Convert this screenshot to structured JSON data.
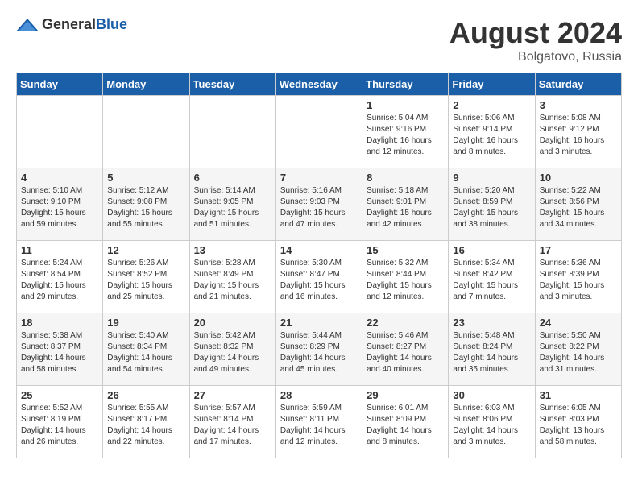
{
  "header": {
    "logo_general": "General",
    "logo_blue": "Blue",
    "month": "August 2024",
    "location": "Bolgatovo, Russia"
  },
  "weekdays": [
    "Sunday",
    "Monday",
    "Tuesday",
    "Wednesday",
    "Thursday",
    "Friday",
    "Saturday"
  ],
  "weeks": [
    [
      {
        "day": "",
        "info": ""
      },
      {
        "day": "",
        "info": ""
      },
      {
        "day": "",
        "info": ""
      },
      {
        "day": "",
        "info": ""
      },
      {
        "day": "1",
        "info": "Sunrise: 5:04 AM\nSunset: 9:16 PM\nDaylight: 16 hours\nand 12 minutes."
      },
      {
        "day": "2",
        "info": "Sunrise: 5:06 AM\nSunset: 9:14 PM\nDaylight: 16 hours\nand 8 minutes."
      },
      {
        "day": "3",
        "info": "Sunrise: 5:08 AM\nSunset: 9:12 PM\nDaylight: 16 hours\nand 3 minutes."
      }
    ],
    [
      {
        "day": "4",
        "info": "Sunrise: 5:10 AM\nSunset: 9:10 PM\nDaylight: 15 hours\nand 59 minutes."
      },
      {
        "day": "5",
        "info": "Sunrise: 5:12 AM\nSunset: 9:08 PM\nDaylight: 15 hours\nand 55 minutes."
      },
      {
        "day": "6",
        "info": "Sunrise: 5:14 AM\nSunset: 9:05 PM\nDaylight: 15 hours\nand 51 minutes."
      },
      {
        "day": "7",
        "info": "Sunrise: 5:16 AM\nSunset: 9:03 PM\nDaylight: 15 hours\nand 47 minutes."
      },
      {
        "day": "8",
        "info": "Sunrise: 5:18 AM\nSunset: 9:01 PM\nDaylight: 15 hours\nand 42 minutes."
      },
      {
        "day": "9",
        "info": "Sunrise: 5:20 AM\nSunset: 8:59 PM\nDaylight: 15 hours\nand 38 minutes."
      },
      {
        "day": "10",
        "info": "Sunrise: 5:22 AM\nSunset: 8:56 PM\nDaylight: 15 hours\nand 34 minutes."
      }
    ],
    [
      {
        "day": "11",
        "info": "Sunrise: 5:24 AM\nSunset: 8:54 PM\nDaylight: 15 hours\nand 29 minutes."
      },
      {
        "day": "12",
        "info": "Sunrise: 5:26 AM\nSunset: 8:52 PM\nDaylight: 15 hours\nand 25 minutes."
      },
      {
        "day": "13",
        "info": "Sunrise: 5:28 AM\nSunset: 8:49 PM\nDaylight: 15 hours\nand 21 minutes."
      },
      {
        "day": "14",
        "info": "Sunrise: 5:30 AM\nSunset: 8:47 PM\nDaylight: 15 hours\nand 16 minutes."
      },
      {
        "day": "15",
        "info": "Sunrise: 5:32 AM\nSunset: 8:44 PM\nDaylight: 15 hours\nand 12 minutes."
      },
      {
        "day": "16",
        "info": "Sunrise: 5:34 AM\nSunset: 8:42 PM\nDaylight: 15 hours\nand 7 minutes."
      },
      {
        "day": "17",
        "info": "Sunrise: 5:36 AM\nSunset: 8:39 PM\nDaylight: 15 hours\nand 3 minutes."
      }
    ],
    [
      {
        "day": "18",
        "info": "Sunrise: 5:38 AM\nSunset: 8:37 PM\nDaylight: 14 hours\nand 58 minutes."
      },
      {
        "day": "19",
        "info": "Sunrise: 5:40 AM\nSunset: 8:34 PM\nDaylight: 14 hours\nand 54 minutes."
      },
      {
        "day": "20",
        "info": "Sunrise: 5:42 AM\nSunset: 8:32 PM\nDaylight: 14 hours\nand 49 minutes."
      },
      {
        "day": "21",
        "info": "Sunrise: 5:44 AM\nSunset: 8:29 PM\nDaylight: 14 hours\nand 45 minutes."
      },
      {
        "day": "22",
        "info": "Sunrise: 5:46 AM\nSunset: 8:27 PM\nDaylight: 14 hours\nand 40 minutes."
      },
      {
        "day": "23",
        "info": "Sunrise: 5:48 AM\nSunset: 8:24 PM\nDaylight: 14 hours\nand 35 minutes."
      },
      {
        "day": "24",
        "info": "Sunrise: 5:50 AM\nSunset: 8:22 PM\nDaylight: 14 hours\nand 31 minutes."
      }
    ],
    [
      {
        "day": "25",
        "info": "Sunrise: 5:52 AM\nSunset: 8:19 PM\nDaylight: 14 hours\nand 26 minutes."
      },
      {
        "day": "26",
        "info": "Sunrise: 5:55 AM\nSunset: 8:17 PM\nDaylight: 14 hours\nand 22 minutes."
      },
      {
        "day": "27",
        "info": "Sunrise: 5:57 AM\nSunset: 8:14 PM\nDaylight: 14 hours\nand 17 minutes."
      },
      {
        "day": "28",
        "info": "Sunrise: 5:59 AM\nSunset: 8:11 PM\nDaylight: 14 hours\nand 12 minutes."
      },
      {
        "day": "29",
        "info": "Sunrise: 6:01 AM\nSunset: 8:09 PM\nDaylight: 14 hours\nand 8 minutes."
      },
      {
        "day": "30",
        "info": "Sunrise: 6:03 AM\nSunset: 8:06 PM\nDaylight: 14 hours\nand 3 minutes."
      },
      {
        "day": "31",
        "info": "Sunrise: 6:05 AM\nSunset: 8:03 PM\nDaylight: 13 hours\nand 58 minutes."
      }
    ]
  ]
}
